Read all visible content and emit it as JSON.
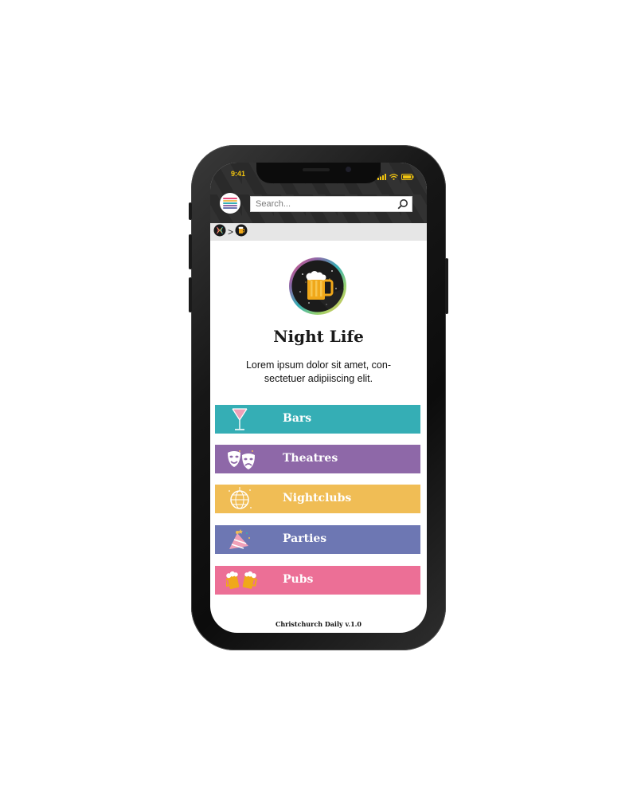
{
  "status": {
    "time": "9:41"
  },
  "search": {
    "placeholder": "Search..."
  },
  "page": {
    "title": "Night Life",
    "description_line1": "Lorem ipsum dolor sit amet, con-",
    "description_line2": "sectetuer adipiiscing elit."
  },
  "categories": [
    {
      "label": "Bars",
      "color": "#35aeb5",
      "icon": "cocktail-glass-icon"
    },
    {
      "label": "Theatres",
      "color": "#8e68a8",
      "icon": "theatre-masks-icon"
    },
    {
      "label": "Nightclubs",
      "color": "#f0bd55",
      "icon": "disco-ball-icon"
    },
    {
      "label": "Parties",
      "color": "#6d77b3",
      "icon": "party-hat-icon"
    },
    {
      "label": "Pubs",
      "color": "#ec6f96",
      "icon": "beer-mugs-icon"
    }
  ],
  "footer": {
    "text": "Christchurch Daily v.1.0"
  },
  "colors": {
    "accent_yellow": "#f1c40f",
    "header_dark": "#2a2a2a"
  }
}
